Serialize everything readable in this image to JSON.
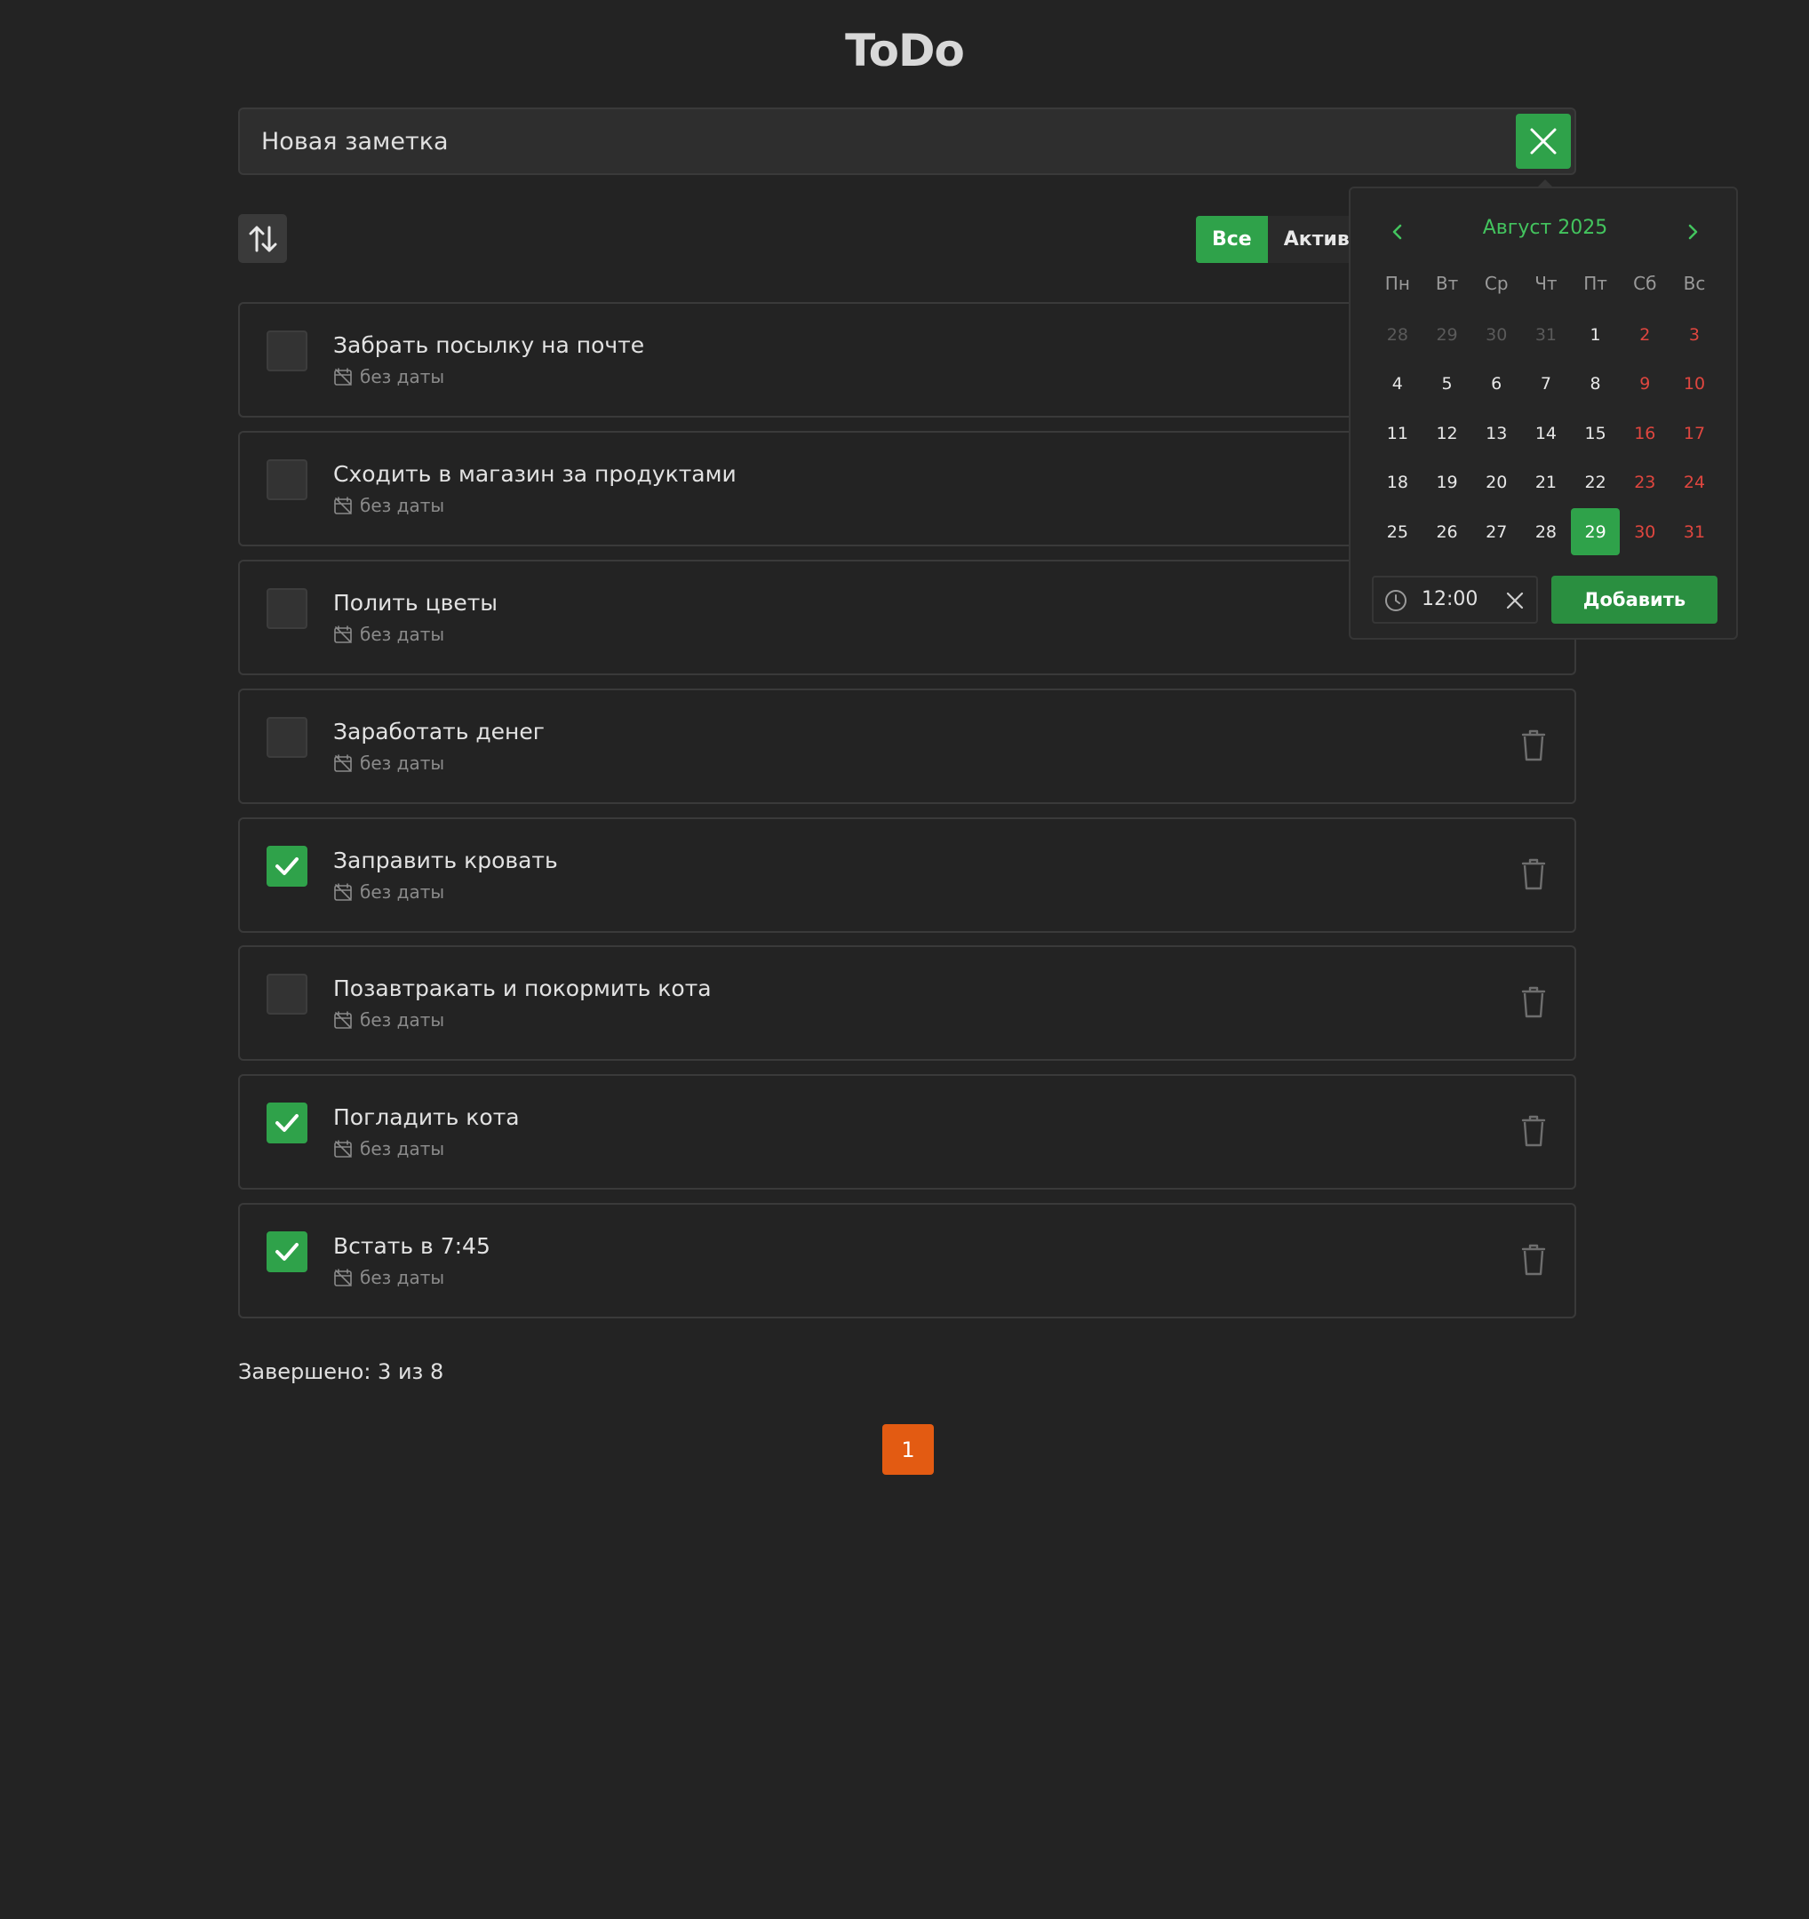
{
  "app": {
    "title": "ToDo"
  },
  "new_note": {
    "placeholder": "Новая заметка"
  },
  "filters": [
    {
      "label": "Все",
      "active": true
    },
    {
      "label": "Активн",
      "active": false
    }
  ],
  "tasks": [
    {
      "title": "Забрать посылку на почте",
      "date": "без даты",
      "done": false
    },
    {
      "title": "Сходить в магазин за продуктами",
      "date": "без даты",
      "done": false
    },
    {
      "title": "Полить цветы",
      "date": "без даты",
      "done": false
    },
    {
      "title": "Заработать денег",
      "date": "без даты",
      "done": false
    },
    {
      "title": "Заправить кровать",
      "date": "без даты",
      "done": true
    },
    {
      "title": "Позавтракать и покормить кота",
      "date": "без даты",
      "done": false
    },
    {
      "title": "Погладить кота",
      "date": "без даты",
      "done": true
    },
    {
      "title": "Встать в 7:45",
      "date": "без даты",
      "done": true
    }
  ],
  "summary": "Завершено: 3 из 8",
  "pagination": {
    "current": "1"
  },
  "calendar": {
    "month_label": "Август 2025",
    "weekdays": [
      "Пн",
      "Вт",
      "Ср",
      "Чт",
      "Пт",
      "Сб",
      "Вс"
    ],
    "weeks": [
      [
        "28",
        "29",
        "30",
        "31",
        "1",
        "2",
        "3"
      ],
      [
        "4",
        "5",
        "6",
        "7",
        "8",
        "9",
        "10"
      ],
      [
        "11",
        "12",
        "13",
        "14",
        "15",
        "16",
        "17"
      ],
      [
        "18",
        "19",
        "20",
        "21",
        "22",
        "23",
        "24"
      ],
      [
        "25",
        "26",
        "27",
        "28",
        "29",
        "30",
        "31"
      ]
    ],
    "selected_day": "29",
    "time": "12:00",
    "add_label": "Добавить"
  },
  "colors": {
    "accent": "#2fa24a",
    "weekend": "#e0463f",
    "page_active": "#e35b12"
  }
}
